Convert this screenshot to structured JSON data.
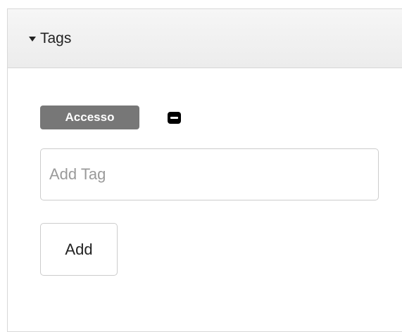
{
  "panel": {
    "title": "Tags",
    "caret_icon": "caret-down-icon"
  },
  "tags": [
    {
      "label": "Accesso",
      "remove_icon": "minus-square-icon"
    }
  ],
  "add_tag_input": {
    "placeholder": "Add Tag",
    "value": ""
  },
  "add_button": {
    "label": "Add"
  },
  "colors": {
    "tag_background": "#777777",
    "heading_background": "#f1f1f1",
    "border": "#cccccc"
  }
}
